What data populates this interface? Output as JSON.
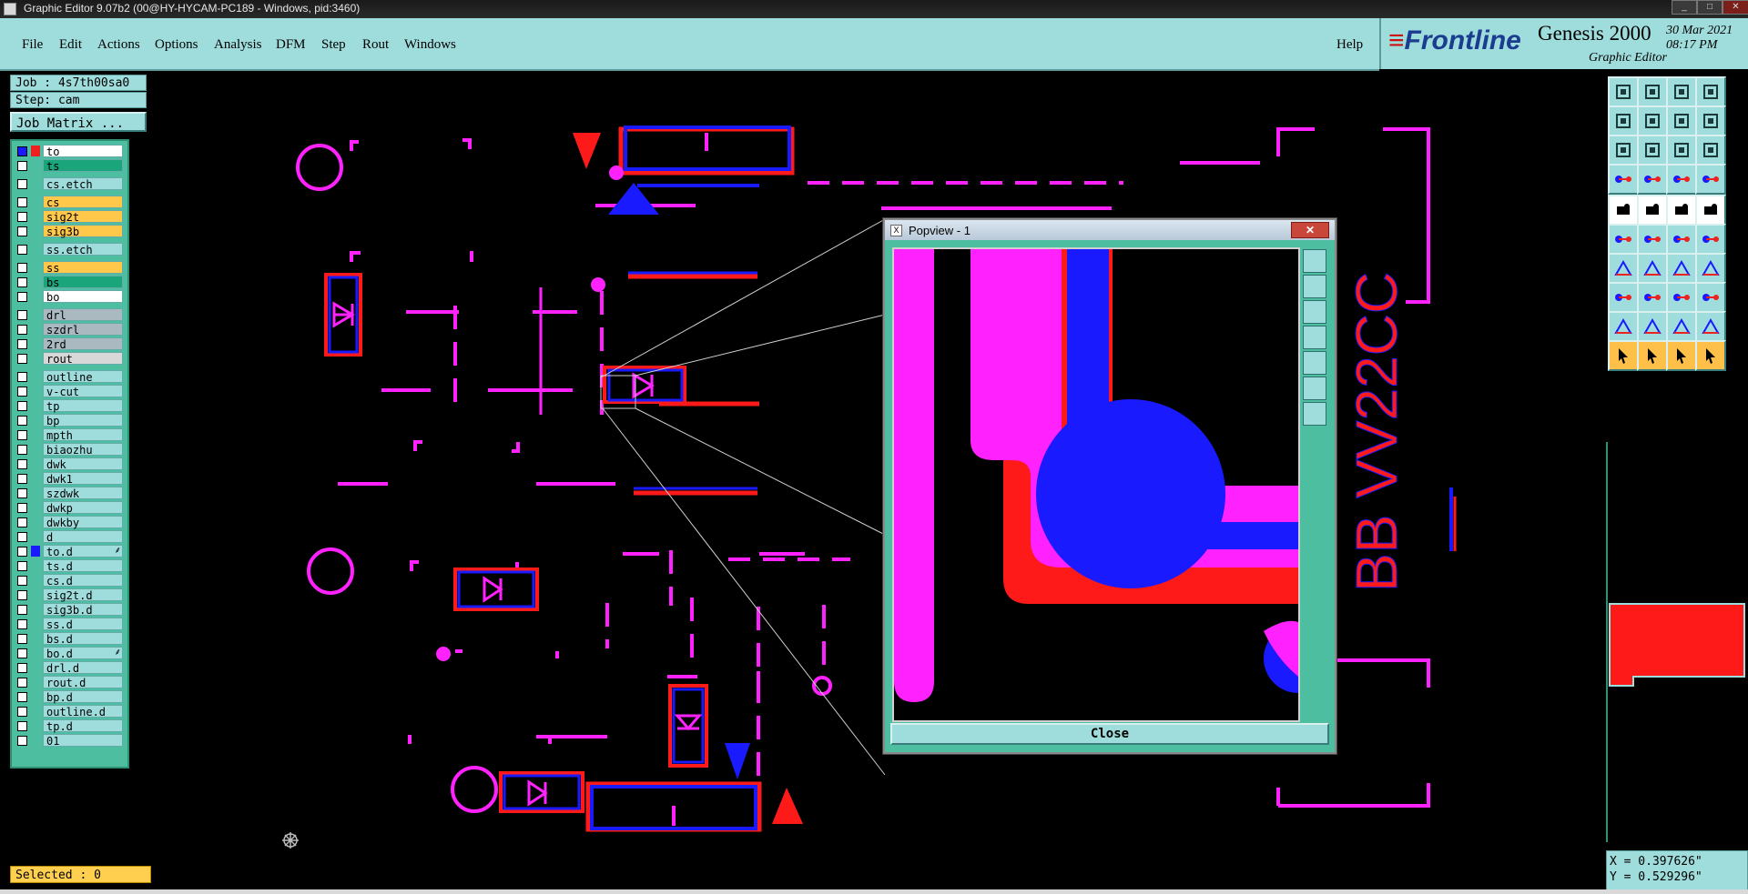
{
  "window": {
    "title": "Graphic Editor 9.07b2 (00@HY-HYCAM-PC189 - Windows, pid:3460)",
    "controls": [
      "_",
      "□",
      "✕"
    ]
  },
  "menu": {
    "items": [
      "File",
      "Edit",
      "Actions",
      "Options",
      "Analysis",
      "DFM",
      "Step",
      "Rout",
      "Windows"
    ],
    "help": "Help"
  },
  "brand": {
    "logo": "Frontline",
    "product": "Genesis 2000",
    "subtitle": "Graphic Editor",
    "date": "30 Mar 2021",
    "time": "08:17 PM"
  },
  "job": {
    "job_label": "Job : 4s7th00sa0",
    "step_label": "Step: cam",
    "matrix_button": "Job Matrix ..."
  },
  "layers": [
    {
      "name": "to",
      "color": "#ffffff",
      "swatch": "#ee2020",
      "work": true
    },
    {
      "name": "ts",
      "color": "#1aa67a",
      "swatch": ""
    },
    {
      "name": "cs.etch",
      "color": "#9fdcdc",
      "swatch": ""
    },
    {
      "name": "cs",
      "color": "#ffc84a",
      "swatch": ""
    },
    {
      "name": "sig2t",
      "color": "#ffc84a",
      "swatch": ""
    },
    {
      "name": "sig3b",
      "color": "#ffc84a",
      "swatch": ""
    },
    {
      "name": "ss.etch",
      "color": "#9fdcdc",
      "swatch": ""
    },
    {
      "name": "ss",
      "color": "#ffc84a",
      "swatch": ""
    },
    {
      "name": "bs",
      "color": "#1aa67a",
      "swatch": ""
    },
    {
      "name": "bo",
      "color": "#ffffff",
      "swatch": ""
    },
    {
      "name": "drl",
      "color": "#aab8c0",
      "swatch": ""
    },
    {
      "name": "szdrl",
      "color": "#aab8c0",
      "swatch": ""
    },
    {
      "name": "2rd",
      "color": "#aab8c0",
      "swatch": ""
    },
    {
      "name": "rout",
      "color": "#d8d8d8",
      "swatch": ""
    },
    {
      "name": "outline",
      "color": "#9fdcdc",
      "swatch": ""
    },
    {
      "name": "v-cut",
      "color": "#9fdcdc",
      "swatch": ""
    },
    {
      "name": "tp",
      "color": "#9fdcdc",
      "swatch": ""
    },
    {
      "name": "bp",
      "color": "#9fdcdc",
      "swatch": ""
    },
    {
      "name": "mpth",
      "color": "#9fdcdc",
      "swatch": ""
    },
    {
      "name": "biaozhu",
      "color": "#9fdcdc",
      "swatch": ""
    },
    {
      "name": "dwk",
      "color": "#9fdcdc",
      "swatch": ""
    },
    {
      "name": "dwk1",
      "color": "#9fdcdc",
      "swatch": ""
    },
    {
      "name": "szdwk",
      "color": "#9fdcdc",
      "swatch": ""
    },
    {
      "name": "dwkp",
      "color": "#9fdcdc",
      "swatch": ""
    },
    {
      "name": "dwkby",
      "color": "#9fdcdc",
      "swatch": ""
    },
    {
      "name": "d",
      "color": "#9fdcdc",
      "swatch": ""
    },
    {
      "name": "to.d",
      "color": "#9fdcdc",
      "swatch": "#1a1aff",
      "mark": "⸙"
    },
    {
      "name": "ts.d",
      "color": "#9fdcdc",
      "swatch": ""
    },
    {
      "name": "cs.d",
      "color": "#9fdcdc",
      "swatch": ""
    },
    {
      "name": "sig2t.d",
      "color": "#9fdcdc",
      "swatch": ""
    },
    {
      "name": "sig3b.d",
      "color": "#9fdcdc",
      "swatch": ""
    },
    {
      "name": "ss.d",
      "color": "#9fdcdc",
      "swatch": ""
    },
    {
      "name": "bs.d",
      "color": "#9fdcdc",
      "swatch": ""
    },
    {
      "name": "bo.d",
      "color": "#9fdcdc",
      "swatch": "",
      "mark": "⸙"
    },
    {
      "name": "drl.d",
      "color": "#9fdcdc",
      "swatch": ""
    },
    {
      "name": "rout.d",
      "color": "#9fdcdc",
      "swatch": ""
    },
    {
      "name": "bp.d",
      "color": "#9fdcdc",
      "swatch": ""
    },
    {
      "name": "outline.d",
      "color": "#9fdcdc",
      "swatch": ""
    },
    {
      "name": "tp.d",
      "color": "#9fdcdc",
      "swatch": ""
    },
    {
      "name": "01",
      "color": "#9fdcdc",
      "swatch": ""
    }
  ],
  "status": {
    "selected": "Selected : 0",
    "x": "X = 0.397626\"",
    "y": "Y = 0.529296\""
  },
  "popview": {
    "title": "Popview - 1",
    "close_x": "X",
    "close_button": "Close"
  },
  "board": {
    "text": "BB VV22CC"
  },
  "colors": {
    "panel": "#9fdcdc",
    "layer_box": "#4dbfa0",
    "magenta": "#ff22ff",
    "red": "#ff1a1a",
    "blue": "#1a1aff",
    "selected_bg": "#ffd050"
  }
}
